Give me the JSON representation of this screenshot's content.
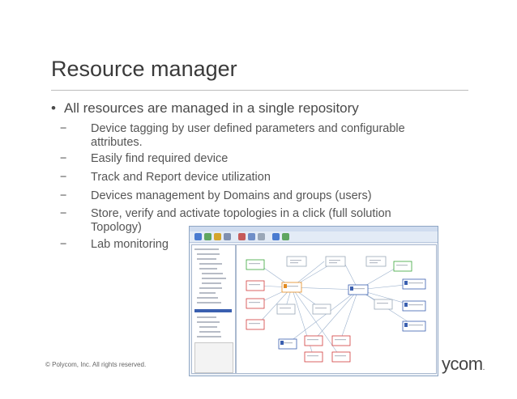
{
  "slide": {
    "title": "Resource manager",
    "bullet": "All resources are managed in a single repository",
    "subs": [
      {
        "line1": "Device tagging by user defined parameters and configurable",
        "line2": "attributes."
      },
      {
        "line1": "Easily find required device"
      },
      {
        "line1": "Track and Report device utilization"
      },
      {
        "line1": "Devices management by Domains and groups (users)"
      },
      {
        "line1": "Store, verify and activate topologies in a click (full solution",
        "line2": "Topology)"
      },
      {
        "line1": "Lab monitoring"
      }
    ],
    "dash": "−",
    "bullet_symbol": "•",
    "copyright": "© Polycom, Inc. All rights reserved.",
    "logo_text": "ycom",
    "logo_mark": "."
  },
  "colors": {
    "title": "#3a3a3a",
    "text": "#4a4a4a",
    "rule": "#bdbdbd",
    "node_green": "#3aa63a",
    "node_red": "#d23c3c",
    "node_orange": "#e38a1f",
    "node_blue": "#3a5fb0",
    "link": "#9ab0cc"
  }
}
